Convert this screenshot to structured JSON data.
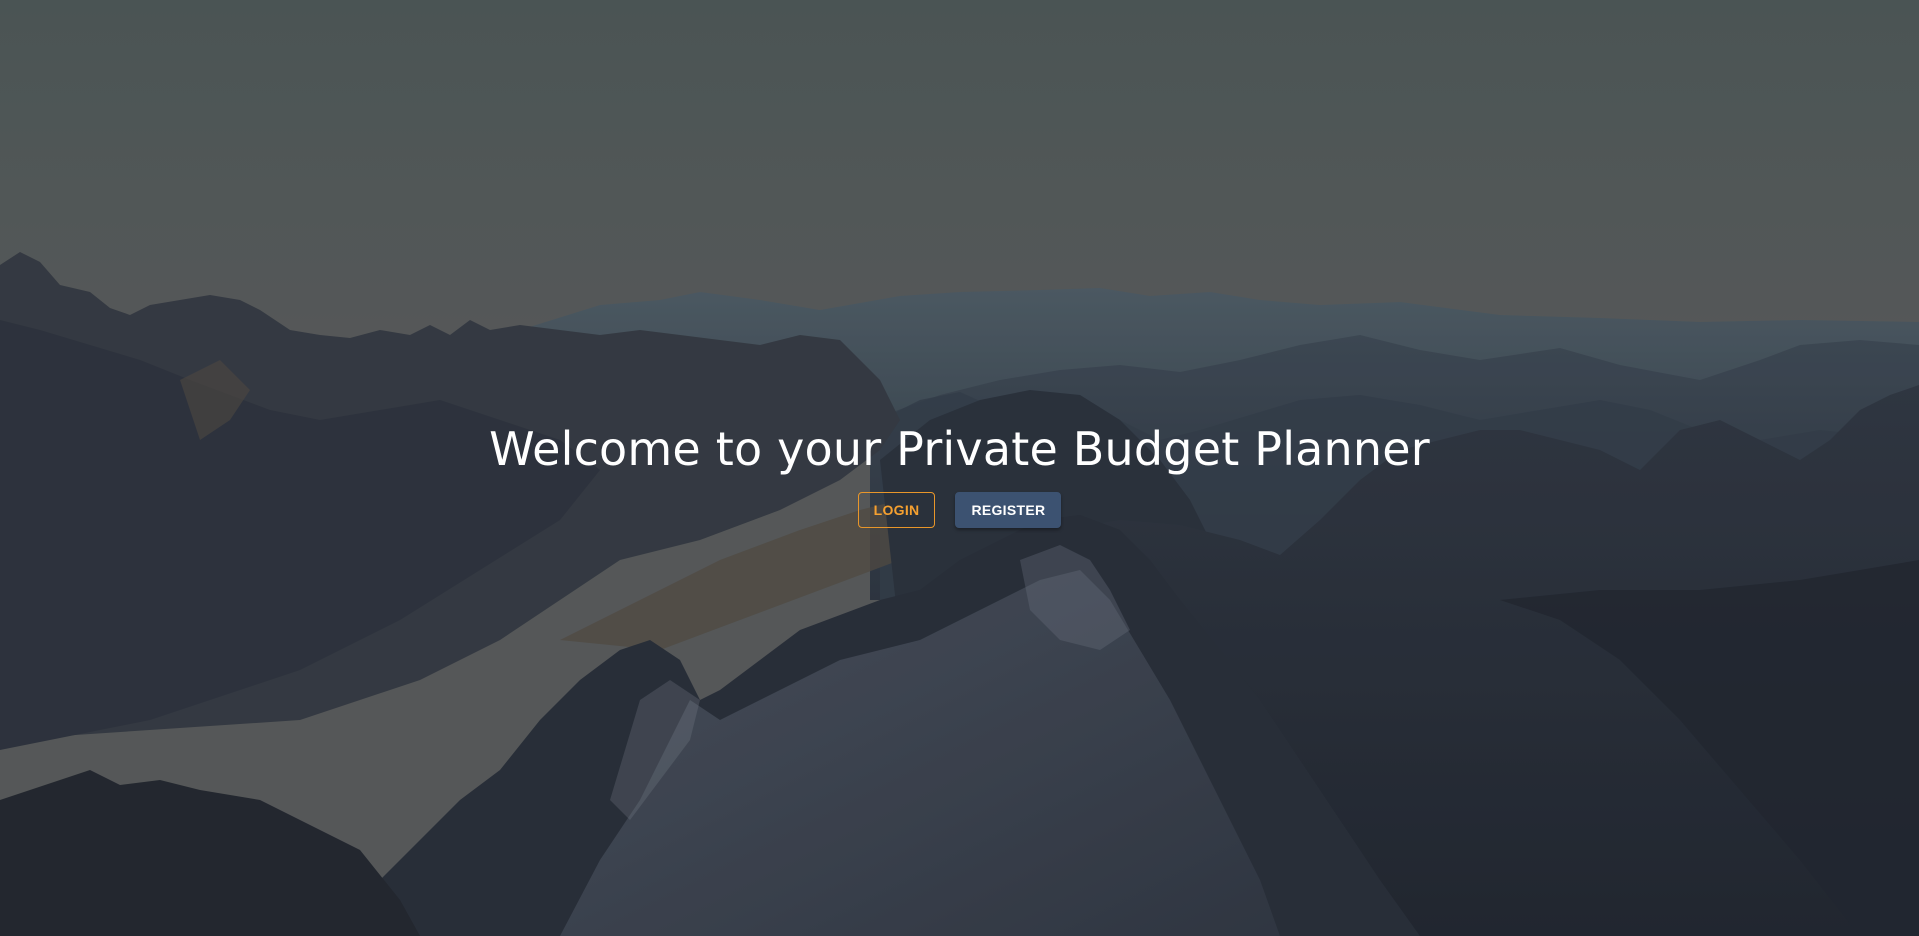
{
  "hero": {
    "title": "Welcome to your Private Budget Planner",
    "background_image": "mountain-range-photo"
  },
  "actions": {
    "login_label": "LOGIN",
    "register_label": "REGISTER"
  },
  "colors": {
    "accent": "#e8962a",
    "primary_button": "#3c5271",
    "title_text": "#ffffff"
  }
}
